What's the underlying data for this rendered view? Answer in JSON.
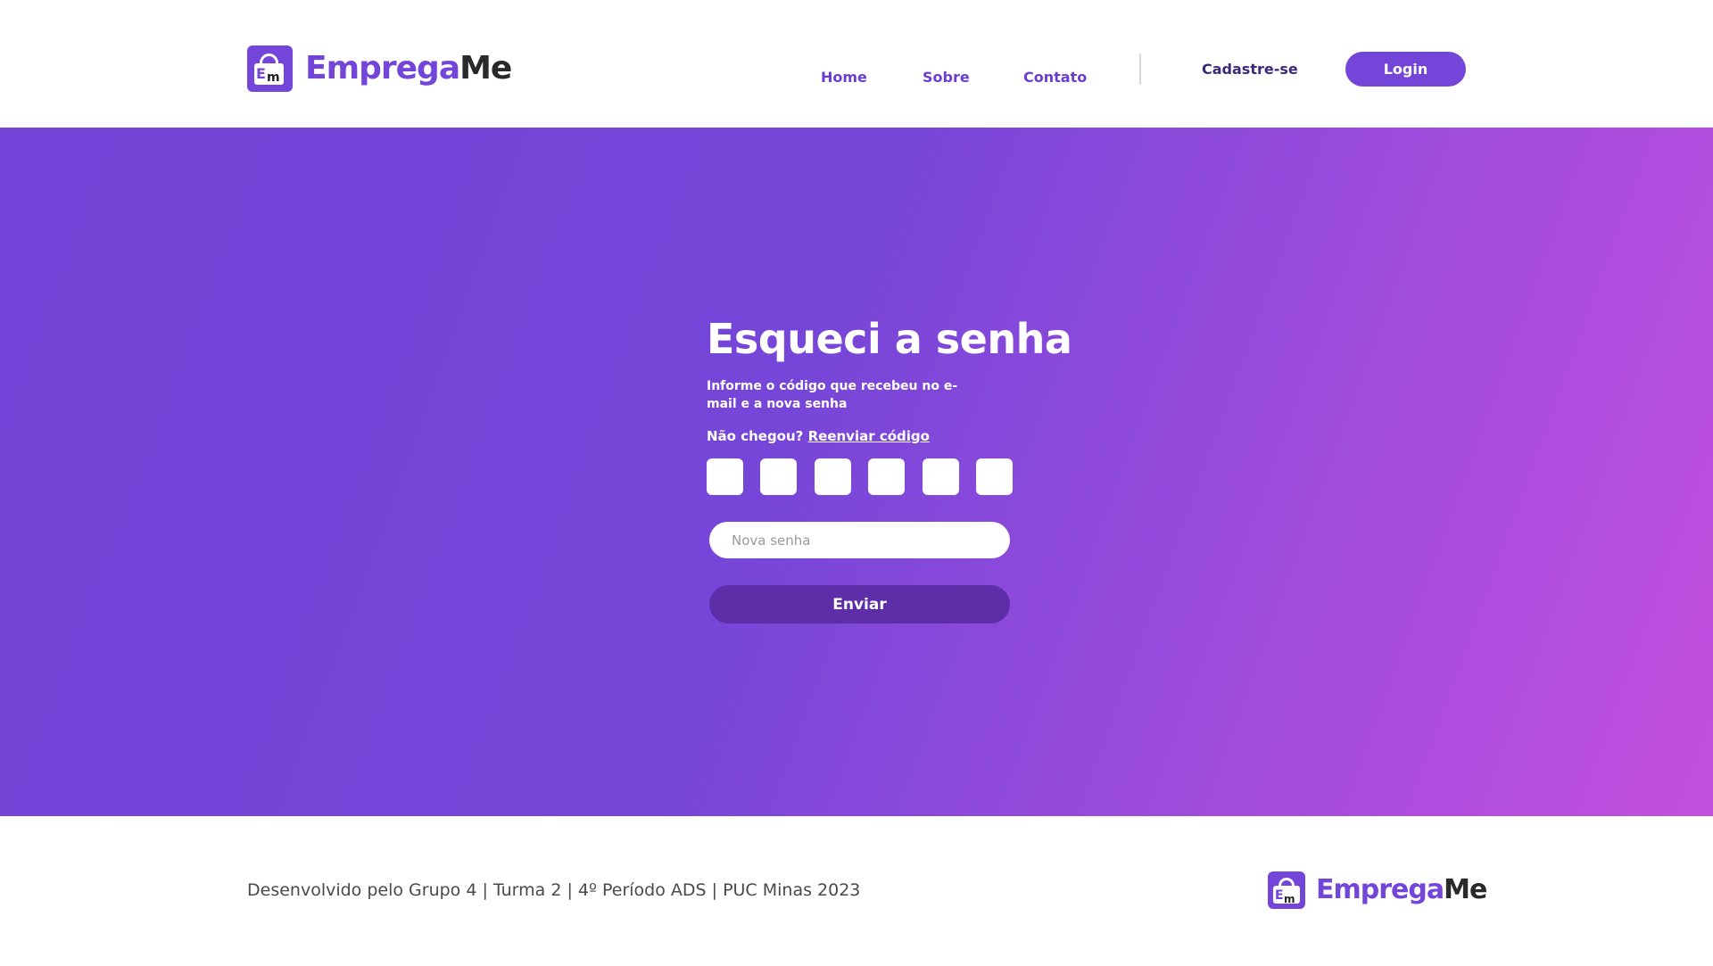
{
  "brand": {
    "name_part1": "Emprega",
    "name_part2": "Me",
    "accent_color": "#7445d9",
    "icon": "briefcase-lock-icon"
  },
  "nav": {
    "home": "Home",
    "sobre": "Sobre",
    "contato": "Contato",
    "signup": "Cadastre-se",
    "login": "Login"
  },
  "form": {
    "title": "Esqueci a senha",
    "subtitle": "Informe o código que recebeu no e-mail e a nova senha",
    "resend_prefix": "Não chegou?",
    "resend_link": "Reenviar código",
    "code_digits": [
      "",
      "",
      "",
      "",
      "",
      ""
    ],
    "password_placeholder": "Nova senha",
    "submit_label": "Enviar"
  },
  "footer": {
    "credits": "Desenvolvido pelo Grupo 4 | Turma 2 | 4º Período ADS | PUC Minas 2023"
  },
  "colors": {
    "gradient_start": "#7143d6",
    "gradient_end": "#c34fdf",
    "button_dark": "#5e2ea8"
  }
}
